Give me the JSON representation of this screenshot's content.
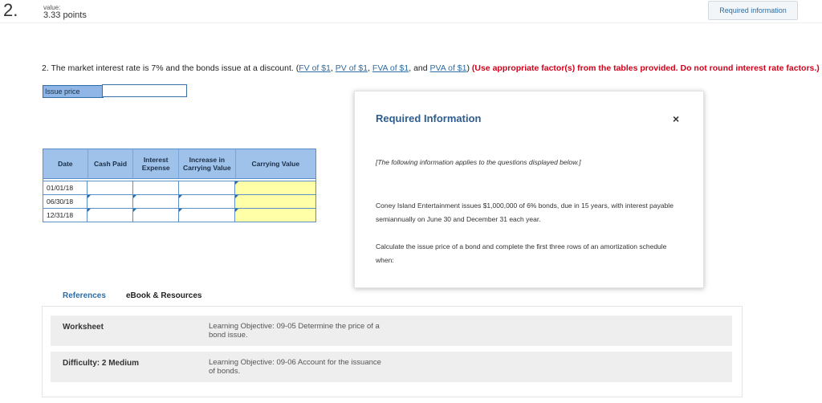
{
  "header": {
    "question_number": "2.",
    "value_label": "value:",
    "points": "3.33 points",
    "required_info_button": "Required information"
  },
  "question": {
    "text": "2. The market interest rate is 7% and the bonds issue at a discount. (",
    "links": [
      "FV of $1",
      "PV of $1",
      "FVA of $1",
      "PVA of $1"
    ],
    "sep1": ", ",
    "sep_and": ", and ",
    "close": ") ",
    "instruction": "(Use appropriate factor(s) from the tables provided. Do not round interest rate factors.)"
  },
  "issue_price": {
    "label": "Issue price",
    "value": ""
  },
  "amortization": {
    "headers": [
      "Date",
      "Cash Paid",
      "Interest Expense",
      "Increase in Carrying Value",
      "Carrying Value"
    ],
    "rows": [
      {
        "date": "01/01/18",
        "cash": "",
        "interest": "",
        "increase": "",
        "carrying": ""
      },
      {
        "date": "06/30/18",
        "cash": "",
        "interest": "",
        "increase": "",
        "carrying": ""
      },
      {
        "date": "12/31/18",
        "cash": "",
        "interest": "",
        "increase": "",
        "carrying": ""
      }
    ]
  },
  "references": {
    "tabs": [
      "References",
      "eBook & Resources"
    ],
    "rows": [
      {
        "title": "Worksheet",
        "objective": "Learning Objective: 09-05 Determine the price of a bond issue."
      },
      {
        "title": "Difficulty: 2 Medium",
        "objective": "Learning Objective: 09-06 Account for the issuance of bonds."
      }
    ]
  },
  "popup": {
    "title": "Required Information",
    "close_icon": "×",
    "note": "[The following information applies to the questions displayed below.]",
    "paragraph1": "Coney Island Entertainment issues $1,000,000 of 6% bonds, due in 15 years, with interest payable semiannually on June 30 and December 31 each year.",
    "paragraph2": "Calculate the issue price of a bond and complete the first three rows of an amortization schedule when:"
  },
  "colors": {
    "accent": "#2d6da3",
    "header_fill": "#9fc2eb",
    "input_highlight": "#ffffa8",
    "instruction_red": "#d0021b"
  }
}
